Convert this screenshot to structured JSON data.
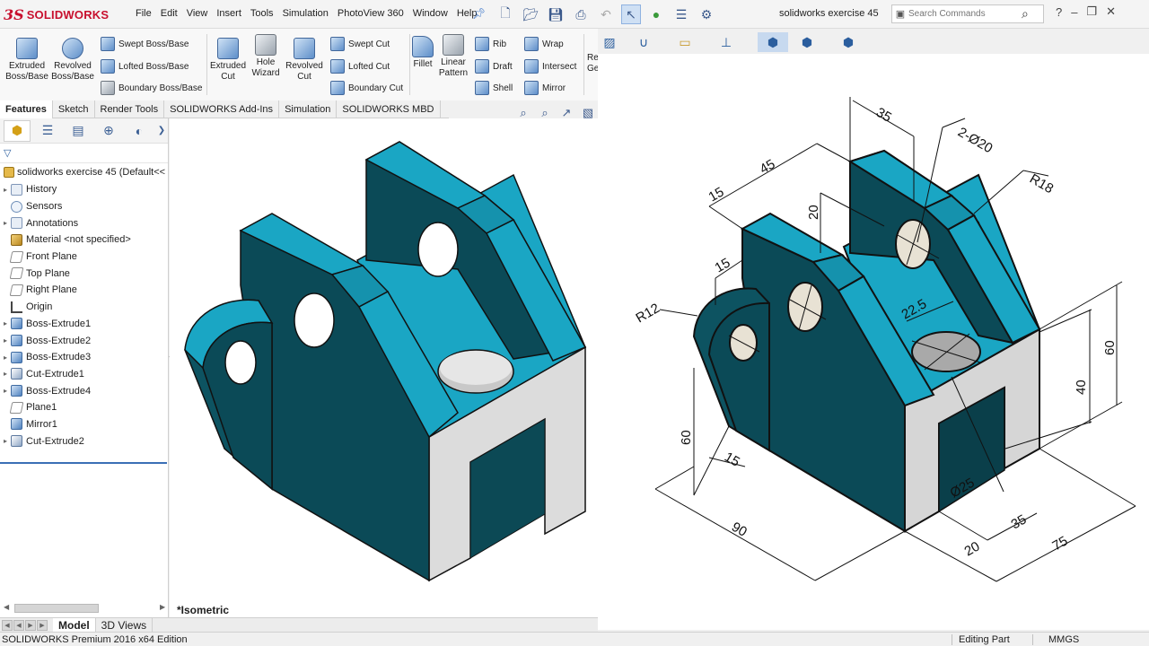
{
  "app": {
    "logo_ds": "3S",
    "logo_name": "SOLIDWORKS",
    "document_title": "solidworks exercise 45",
    "edition": "SOLIDWORKS Premium 2016 x64 Edition"
  },
  "menu": [
    "File",
    "Edit",
    "View",
    "Insert",
    "Tools",
    "Simulation",
    "PhotoView 360",
    "Window",
    "Help"
  ],
  "search": {
    "placeholder": "Search Commands"
  },
  "command_manager": {
    "extruded_boss": "Extruded\nBoss/Base",
    "revolved_boss": "Revolved\nBoss/Base",
    "swept_boss": "Swept Boss/Base",
    "lofted_boss": "Lofted Boss/Base",
    "boundary_boss": "Boundary Boss/Base",
    "extruded_cut": "Extruded\nCut",
    "hole_wizard": "Hole\nWizard",
    "revolved_cut": "Revolved\nCut",
    "swept_cut": "Swept Cut",
    "lofted_cut": "Lofted Cut",
    "boundary_cut": "Boundary Cut",
    "fillet": "Fillet",
    "linear_pattern": "Linear\nPattern",
    "rib": "Rib",
    "draft": "Draft",
    "shell": "Shell",
    "wrap": "Wrap",
    "intersect": "Intersect",
    "mirror": "Mirror",
    "ref_geometry": "Re\nGe"
  },
  "tabs": [
    {
      "label": "Features",
      "active": true
    },
    {
      "label": "Sketch",
      "active": false
    },
    {
      "label": "Render Tools",
      "active": false
    },
    {
      "label": "SOLIDWORKS Add-Ins",
      "active": false
    },
    {
      "label": "Simulation",
      "active": false
    },
    {
      "label": "SOLIDWORKS MBD",
      "active": false
    }
  ],
  "feature_tree": {
    "root": "solidworks exercise 45  (Default<<",
    "items": [
      {
        "label": "History",
        "icon": "folder",
        "expandable": true
      },
      {
        "label": "Sensors",
        "icon": "sensor",
        "expandable": false
      },
      {
        "label": "Annotations",
        "icon": "folder",
        "expandable": true
      },
      {
        "label": "Material <not specified>",
        "icon": "mat",
        "expandable": false
      },
      {
        "label": "Front Plane",
        "icon": "plane",
        "expandable": false
      },
      {
        "label": "Top Plane",
        "icon": "plane",
        "expandable": false
      },
      {
        "label": "Right Plane",
        "icon": "plane",
        "expandable": false
      },
      {
        "label": "Origin",
        "icon": "origin",
        "expandable": false
      },
      {
        "label": "Boss-Extrude1",
        "icon": "feat",
        "expandable": true
      },
      {
        "label": "Boss-Extrude2",
        "icon": "feat",
        "expandable": true
      },
      {
        "label": "Boss-Extrude3",
        "icon": "feat",
        "expandable": true
      },
      {
        "label": "Cut-Extrude1",
        "icon": "cut",
        "expandable": true
      },
      {
        "label": "Boss-Extrude4",
        "icon": "feat",
        "expandable": true
      },
      {
        "label": "Plane1",
        "icon": "plane",
        "expandable": false
      },
      {
        "label": "Mirror1",
        "icon": "feat",
        "expandable": false
      },
      {
        "label": "Cut-Extrude2",
        "icon": "cut",
        "expandable": true
      }
    ]
  },
  "viewport": {
    "view_label": "*Isometric"
  },
  "model_tabs": [
    {
      "label": "Model",
      "active": true
    },
    {
      "label": "3D Views",
      "active": false
    }
  ],
  "status": {
    "mode": "Editing Part",
    "units": "MMGS"
  },
  "drawing": {
    "dims": {
      "d35_top": "35",
      "holes": "2-Ø20",
      "d45": "45",
      "d15_a": "15",
      "d20": "20",
      "r18": "R18",
      "d15_b": "15",
      "r12": "R12",
      "d22_5": "22.5",
      "d60_right": "60",
      "d40": "40",
      "d60_left": "60",
      "d15_c": "15",
      "d90": "90",
      "phi25": "Ø25",
      "d35_bottom": "35",
      "d20_bottom": "20",
      "d75": "75"
    }
  },
  "colors": {
    "teal_top": "#1aa6c4",
    "teal_dark": "#0a4a57",
    "teal_mid": "#136f82",
    "grey_face": "#d9d9d9"
  }
}
